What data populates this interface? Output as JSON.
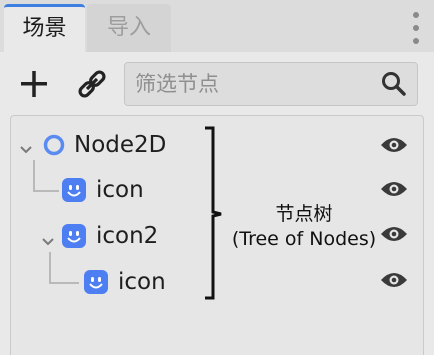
{
  "tabs": [
    {
      "label": "场景",
      "active": true
    },
    {
      "label": "导入",
      "active": false
    }
  ],
  "toolbar": {
    "add_icon": "plus-icon",
    "link_icon": "link-icon"
  },
  "search": {
    "placeholder": "筛选节点",
    "value": "",
    "icon": "search-icon"
  },
  "tree": {
    "nodes": [
      {
        "label": "Node2D",
        "type": "node2d",
        "expanded": true
      },
      {
        "label": "icon",
        "type": "sprite"
      },
      {
        "label": "icon2",
        "type": "sprite",
        "expanded": true
      },
      {
        "label": "icon",
        "type": "sprite"
      }
    ]
  },
  "annotation": {
    "line1": "节点树",
    "line2": "(Tree of Nodes)"
  },
  "colors": {
    "accent": "#3d7fe0",
    "node2d": "#5a8bf0",
    "sprite": "#4d7ef2",
    "panel_bg": "#e9e9e9",
    "text": "#1e1e1e"
  }
}
